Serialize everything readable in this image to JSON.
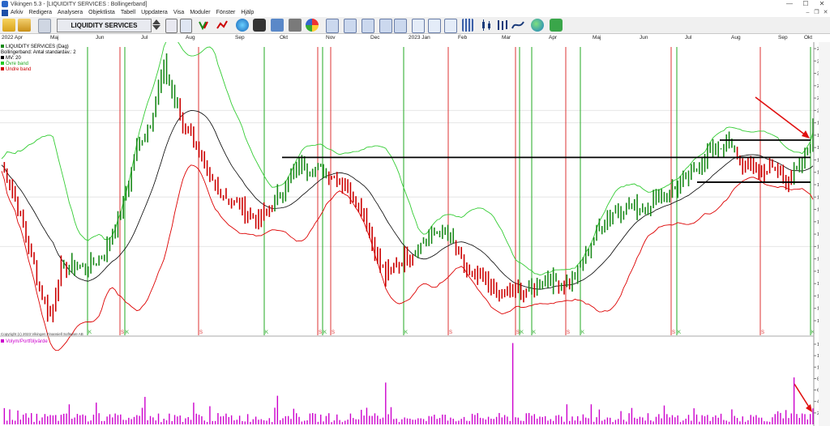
{
  "window": {
    "title": "Vikingen 5.3 - [LIQUIDITY SERVICES : Bollingerband]",
    "controls": [
      "—",
      "☐",
      "✕"
    ]
  },
  "menu": {
    "items": [
      "Arkiv",
      "Redigera",
      "Analysera",
      "Objektlista",
      "Tabell",
      "Uppdatera",
      "Visa",
      "Moduler",
      "Fönster",
      "Hjälp"
    ],
    "mdi_controls": [
      "–",
      "❐",
      "✕"
    ]
  },
  "toolbar": {
    "symbol": "LIQUIDITY SERVICES"
  },
  "time_axis": {
    "labels": [
      "2022 Apr",
      "Maj",
      "Jun",
      "Jul",
      "Aug",
      "Sep",
      "Okt",
      "Nov",
      "Dec",
      "2023 Jan",
      "Feb",
      "Mar",
      "Apr",
      "Maj",
      "Jun",
      "Jul",
      "Aug",
      "Sep",
      "Okt"
    ]
  },
  "legend": {
    "items": [
      {
        "label": "LIQUIDITY SERVICES (Dag)",
        "color": "#1a8a1a"
      },
      {
        "label": "Bollingerband: Antal standardav.: 2",
        "color": ""
      },
      {
        "label": "MV: 20",
        "color": "#000000"
      },
      {
        "label": "Övre band",
        "color": "#22cc22"
      },
      {
        "label": "Undre band",
        "color": "#cc0000"
      }
    ]
  },
  "copyright": "Copyright (c) 2023 Vikingen Finansiell Software AB",
  "volume_legend": {
    "label": "Volym/Portföljvärde",
    "color": "#cc00cc"
  },
  "price_axis": {
    "ticks": [
      "22.5",
      "22.0",
      "21.5",
      "21.0",
      "20.5",
      "20.0",
      "19.5",
      "19.0",
      "18.5",
      "18.0",
      "17.5",
      "17.0",
      "16.5",
      "16.0",
      "15.5",
      "15.0",
      "14.5",
      "14.0",
      "13.5",
      "13.0",
      "12.5",
      "12.0",
      "11.5"
    ]
  },
  "volume_axis": {
    "ticks": [
      "1400",
      "1200",
      "1000",
      "800",
      "600",
      "400",
      "200"
    ]
  },
  "signals": [
    {
      "type": "K"
    },
    {
      "type": "S"
    },
    {
      "type": "K"
    },
    {
      "type": "S"
    },
    {
      "type": "K"
    },
    {
      "type": "S"
    },
    {
      "type": "K"
    },
    {
      "type": "S"
    },
    {
      "type": "K"
    },
    {
      "type": "S"
    },
    {
      "type": "S"
    },
    {
      "type": "K"
    },
    {
      "type": "K"
    },
    {
      "type": "S"
    },
    {
      "type": "K"
    },
    {
      "type": "S"
    },
    {
      "type": "K"
    },
    {
      "type": "S"
    },
    {
      "type": "K"
    }
  ],
  "colors": {
    "up": "#1a8a1a",
    "down": "#cc0000",
    "ma": "#000000",
    "upper": "#33cc33",
    "lower": "#dd0000",
    "buy_line": "#22aa22",
    "sell_line": "#dd3333",
    "volume": "#cc00cc",
    "arrow": "#e01010"
  },
  "chart_data": {
    "type": "ohlc",
    "scale_min": 11.5,
    "scale_max": 22.5,
    "series": [
      {
        "name": "LIQUIDITY SERVICES (Dag)",
        "anchors": [
          [
            0,
            17.8
          ],
          [
            5,
            16.5
          ],
          [
            10,
            14.5
          ],
          [
            15,
            12.5
          ],
          [
            18,
            11.7
          ],
          [
            22,
            13.6
          ],
          [
            27,
            13.7
          ],
          [
            32,
            13.6
          ],
          [
            38,
            14.2
          ],
          [
            45,
            16.2
          ],
          [
            50,
            18.5
          ],
          [
            55,
            19.5
          ],
          [
            60,
            21.8
          ],
          [
            63,
            20.8
          ],
          [
            67,
            19.3
          ],
          [
            70,
            19.2
          ],
          [
            75,
            17.5
          ],
          [
            80,
            16.8
          ],
          [
            85,
            16.3
          ],
          [
            90,
            16.0
          ],
          [
            95,
            15.5
          ],
          [
            102,
            16.5
          ],
          [
            110,
            17.8
          ],
          [
            118,
            17.6
          ],
          [
            122,
            17.4
          ],
          [
            128,
            16.9
          ],
          [
            134,
            15.8
          ],
          [
            138,
            14.3
          ],
          [
            142,
            13.3
          ],
          [
            146,
            13.8
          ],
          [
            150,
            14.1
          ],
          [
            155,
            14.6
          ],
          [
            162,
            15.2
          ],
          [
            168,
            14.5
          ],
          [
            172,
            13.4
          ],
          [
            178,
            13.1
          ],
          [
            184,
            12.5
          ],
          [
            190,
            12.8
          ],
          [
            195,
            12.7
          ],
          [
            200,
            13.2
          ],
          [
            206,
            13.1
          ],
          [
            210,
            13.0
          ],
          [
            214,
            13.7
          ],
          [
            220,
            15.1
          ],
          [
            226,
            15.9
          ],
          [
            232,
            16.1
          ],
          [
            238,
            16.1
          ],
          [
            244,
            16.6
          ],
          [
            250,
            16.9
          ],
          [
            256,
            17.5
          ],
          [
            262,
            18.4
          ],
          [
            268,
            18.6
          ],
          [
            274,
            17.9
          ],
          [
            280,
            17.6
          ],
          [
            286,
            17.6
          ],
          [
            291,
            17.2
          ],
          [
            296,
            17.8
          ],
          [
            300,
            19.2
          ]
        ]
      },
      {
        "name": "MV: 20",
        "color": "#000000"
      },
      {
        "name": "Övre band",
        "color": "#33cc33"
      },
      {
        "name": "Undre band",
        "color": "#dd0000"
      }
    ],
    "horizontal_lines": [
      18.1,
      18.8,
      17.1
    ],
    "volume_max": 1400
  }
}
